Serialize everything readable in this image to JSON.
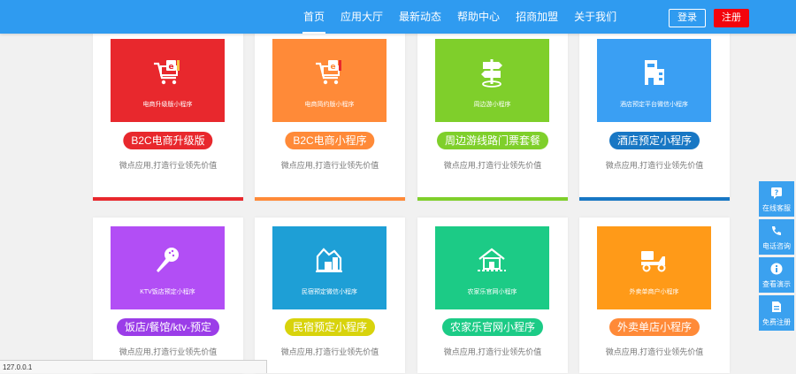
{
  "nav": {
    "items": [
      "首页",
      "应用大厅",
      "最新动态",
      "帮助中心",
      "招商加盟",
      "关于我们"
    ],
    "login": "登录",
    "register": "注册"
  },
  "cards": [
    {
      "thumb_label": "电商升级版小程序",
      "title": "B2C电商升级版",
      "desc": "微点应用,打造行业领先价值",
      "color": "#e8282d",
      "icon": "cart-icon"
    },
    {
      "thumb_label": "电商简约版小程序",
      "title": "B2C电商小程序",
      "desc": "微点应用,打造行业领先价值",
      "color": "#ff8a38",
      "icon": "cart-icon"
    },
    {
      "thumb_label": "周边游小程序",
      "title": "周边游线路门票套餐",
      "desc": "微点应用,打造行业领先价值",
      "color": "#7fcf2b",
      "icon": "signpost-icon"
    },
    {
      "thumb_label": "酒店预定平台微信小程序",
      "title": "酒店预定小程序",
      "desc": "微点应用,打造行业领先价值",
      "color": "#3a9ff3",
      "icon": "hotel-icon"
    },
    {
      "thumb_label": "KTV饭店预定小程序",
      "title": "饭店/餐馆/ktv-预定",
      "desc": "微点应用,打造行业领先价值",
      "color": "#b24ef5",
      "icon": "microphone-icon"
    },
    {
      "thumb_label": "民宿预定微信小程序",
      "title": "民宿预定小程序",
      "desc": "微点应用,打造行业领先价值",
      "color": "#1e9fd6",
      "icon": "homestay-icon"
    },
    {
      "thumb_label": "农家乐官网小程序",
      "title": "农家乐官网小程序",
      "desc": "微点应用,打造行业领先价值",
      "color": "#1ccb86",
      "icon": "farmhouse-icon"
    },
    {
      "thumb_label": "外卖单商户小程序",
      "title": "外卖单店小程序",
      "desc": "微点应用,打造行业领先价值",
      "color": "#ff9a18",
      "icon": "delivery-icon"
    }
  ],
  "pill_colors": [
    "#e8282d",
    "#ff8a38",
    "#7fcf2b",
    "#1877c4",
    "#9b3de8",
    "#d8d30c",
    "#1ccb86",
    "#ff8a38"
  ],
  "bar_colors": [
    "#e8282d",
    "#ff8a38",
    "#7fcf2b",
    "#1877c4"
  ],
  "float": [
    {
      "label": "在线客服",
      "icon": "question-icon"
    },
    {
      "label": "电话咨询",
      "icon": "phone-icon"
    },
    {
      "label": "查看演示",
      "icon": "info-icon"
    },
    {
      "label": "免费注册",
      "icon": "document-icon"
    }
  ],
  "status_text": "127.0.0.1"
}
